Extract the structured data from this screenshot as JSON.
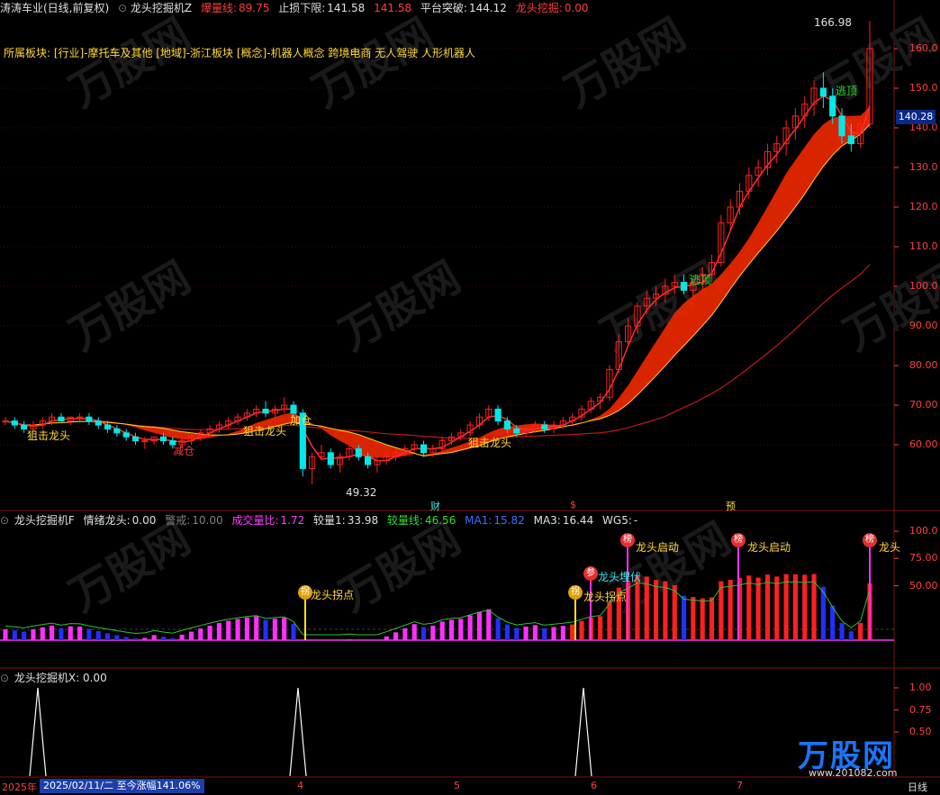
{
  "colors": {
    "red": "#ff2020",
    "green": "#20e020",
    "cyan": "#00e8e8",
    "yellow": "#ffd020",
    "blue": "#2030ff",
    "magenta": "#ff30ff",
    "grid": "#801010"
  },
  "main_panel": {
    "stock_name": "涛涛车业(日线,前复权)",
    "indicator_name": "龙头挖掘机Z",
    "burst_label": "爆量线:",
    "burst_value": "89.75",
    "stop_label": "止损下限:",
    "stop_value": "141.58",
    "stop_value2": "141.58",
    "platform_label": "平台突破:",
    "platform_value": "144.12",
    "dig_label": "龙头挖掘:",
    "dig_value": "0.00",
    "sector_line": "所属板块: [行业]-摩托车及其他 [地域]-浙江板块 [概念]-机器人概念 跨境电商 无人驾驶 人形机器人",
    "y_ticks": [
      "160.0",
      "150.0",
      "140.0",
      "130.0",
      "120.0",
      "110.0",
      "100.0",
      "90.00",
      "80.00",
      "70.00",
      "60.00"
    ],
    "current_price": "140.28",
    "high_label": "166.98",
    "low_label": "49.32",
    "annotations": [
      "狙击龙头",
      "狙击龙头",
      "狙击龙头",
      "加仓",
      "减仓",
      "逃顶",
      "逃顶"
    ],
    "event_markers": [
      "财",
      "$",
      "预"
    ]
  },
  "sub_panel1": {
    "indicator_name": "龙头挖掘机F",
    "mood_label": "情绪龙头:",
    "mood_value": "0.00",
    "warn_label": "警戒:",
    "warn_value": "10.00",
    "vol_ratio_label": "成交量比:",
    "vol_ratio_value": "1.72",
    "cmp1_label": "较量1:",
    "cmp1_value": "33.98",
    "cmp_line_label": "较量线:",
    "cmp_line_value": "46.56",
    "ma1_label": "MA1:",
    "ma1_value": "15.82",
    "ma3_label": "MA3:",
    "ma3_value": "16.44",
    "wg5_label": "WG5:",
    "wg5_value": "-",
    "y_ticks": [
      "100.0",
      "75.00",
      "50.00"
    ],
    "signals": [
      "龙头拐点",
      "龙头拐点",
      "龙头埋伏",
      "龙头启动",
      "龙头启动",
      "龙头"
    ],
    "badges": [
      "拐",
      "拐",
      "参",
      "榜",
      "榜",
      "榜"
    ]
  },
  "sub_panel2": {
    "indicator_name": "龙头挖掘机X",
    "value": ": 0.00",
    "y_ticks": [
      "1.00",
      "0.75",
      "0.50"
    ]
  },
  "footer": {
    "year": "2025年",
    "date_info": "2025/02/11/二 至今涨幅141.06%",
    "months": [
      "4",
      "5",
      "6",
      "7"
    ],
    "period": "日线"
  },
  "watermark": {
    "brand": "万股网",
    "url": "www.201082.com"
  },
  "chart_data": {
    "type": "candlestick",
    "y_range": [
      45,
      170
    ],
    "candles": [
      [
        66,
        67,
        65,
        66
      ],
      [
        66,
        67,
        64,
        65
      ],
      [
        65,
        66,
        63,
        64
      ],
      [
        64,
        66,
        63,
        65
      ],
      [
        65,
        67,
        64,
        66
      ],
      [
        66,
        68,
        65,
        67
      ],
      [
        67,
        68,
        66,
        66
      ],
      [
        66,
        67,
        65,
        67
      ],
      [
        67,
        68,
        66,
        67
      ],
      [
        67,
        68,
        65,
        66
      ],
      [
        66,
        67,
        64,
        65
      ],
      [
        65,
        66,
        63,
        64
      ],
      [
        64,
        65,
        62,
        63
      ],
      [
        63,
        64,
        61,
        62
      ],
      [
        62,
        63,
        60,
        61
      ],
      [
        61,
        62,
        59,
        61
      ],
      [
        61,
        62,
        60,
        62
      ],
      [
        62,
        63,
        60,
        61
      ],
      [
        61,
        62,
        59,
        60
      ],
      [
        60,
        62,
        59,
        61
      ],
      [
        61,
        63,
        60,
        62
      ],
      [
        62,
        64,
        61,
        63
      ],
      [
        63,
        65,
        62,
        64
      ],
      [
        64,
        66,
        63,
        65
      ],
      [
        65,
        67,
        64,
        66
      ],
      [
        66,
        68,
        65,
        67
      ],
      [
        67,
        69,
        66,
        68
      ],
      [
        68,
        70,
        67,
        69
      ],
      [
        69,
        71,
        67,
        68
      ],
      [
        68,
        70,
        66,
        69
      ],
      [
        69,
        72,
        68,
        70
      ],
      [
        70,
        71,
        67,
        68
      ],
      [
        68,
        69,
        52,
        54
      ],
      [
        54,
        58,
        50,
        57
      ],
      [
        57,
        60,
        56,
        58
      ],
      [
        58,
        59,
        54,
        55
      ],
      [
        55,
        58,
        53,
        57
      ],
      [
        57,
        60,
        56,
        59
      ],
      [
        59,
        60,
        56,
        57
      ],
      [
        57,
        58,
        54,
        55
      ],
      [
        55,
        57,
        53,
        56
      ],
      [
        56,
        58,
        55,
        57
      ],
      [
        57,
        59,
        56,
        58
      ],
      [
        58,
        60,
        57,
        59
      ],
      [
        59,
        61,
        58,
        60
      ],
      [
        60,
        61,
        57,
        58
      ],
      [
        58,
        60,
        57,
        59
      ],
      [
        59,
        62,
        58,
        61
      ],
      [
        61,
        63,
        60,
        62
      ],
      [
        62,
        64,
        61,
        63
      ],
      [
        63,
        66,
        62,
        65
      ],
      [
        65,
        68,
        64,
        67
      ],
      [
        67,
        70,
        66,
        69
      ],
      [
        69,
        70,
        65,
        66
      ],
      [
        66,
        67,
        63,
        64
      ],
      [
        64,
        65,
        62,
        63
      ],
      [
        63,
        65,
        62,
        64
      ],
      [
        64,
        66,
        63,
        65
      ],
      [
        65,
        66,
        63,
        64
      ],
      [
        64,
        66,
        63,
        65
      ],
      [
        65,
        67,
        64,
        66
      ],
      [
        66,
        68,
        65,
        67
      ],
      [
        67,
        70,
        66,
        69
      ],
      [
        69,
        72,
        68,
        71
      ],
      [
        71,
        73,
        69,
        72
      ],
      [
        72,
        80,
        71,
        79
      ],
      [
        79,
        88,
        78,
        86
      ],
      [
        86,
        92,
        85,
        90
      ],
      [
        90,
        96,
        88,
        95
      ],
      [
        95,
        99,
        93,
        97
      ],
      [
        97,
        100,
        95,
        98
      ],
      [
        98,
        102,
        96,
        100
      ],
      [
        100,
        103,
        98,
        101
      ],
      [
        101,
        103,
        98,
        99
      ],
      [
        99,
        102,
        97,
        101
      ],
      [
        101,
        105,
        99,
        103
      ],
      [
        103,
        108,
        101,
        106
      ],
      [
        106,
        118,
        105,
        116
      ],
      [
        116,
        122,
        114,
        120
      ],
      [
        120,
        126,
        118,
        124
      ],
      [
        124,
        130,
        122,
        128
      ],
      [
        128,
        132,
        125,
        130
      ],
      [
        130,
        136,
        128,
        134
      ],
      [
        134,
        138,
        131,
        136
      ],
      [
        136,
        142,
        133,
        140
      ],
      [
        140,
        145,
        137,
        143
      ],
      [
        143,
        148,
        140,
        146
      ],
      [
        146,
        152,
        143,
        150
      ],
      [
        150,
        154,
        145,
        148
      ],
      [
        148,
        150,
        141,
        143
      ],
      [
        143,
        145,
        136,
        138
      ],
      [
        138,
        141,
        134,
        136
      ],
      [
        136,
        142,
        135,
        141
      ],
      [
        141,
        167,
        140,
        160
      ]
    ]
  }
}
